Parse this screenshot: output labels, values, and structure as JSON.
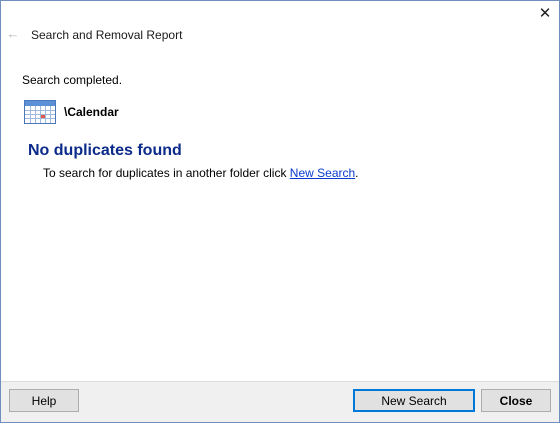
{
  "window": {
    "close_glyph": "✕",
    "back_glyph": "←",
    "title": "Search and Removal Report"
  },
  "report": {
    "status": "Search completed.",
    "folder_path": "\\Calendar",
    "folder_icon": "calendar-icon",
    "headline": "No duplicates found",
    "hint_prefix": "To search for duplicates in another folder click ",
    "hint_link": "New Search",
    "hint_suffix": "."
  },
  "footer": {
    "help_label": "Help",
    "new_search_label": "New Search",
    "close_label": "Close"
  },
  "colors": {
    "headline": "#0b2a8a",
    "link": "#0b3bd0",
    "default_button_border": "#0078d7"
  }
}
